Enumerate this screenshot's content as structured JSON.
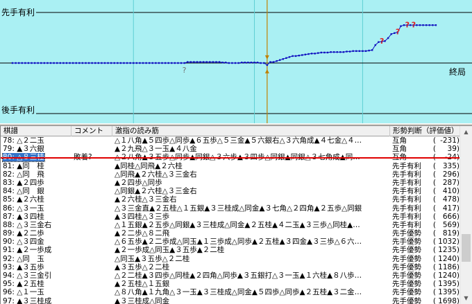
{
  "chart": {
    "label_top": "先手有利",
    "label_bottom": "後手有利",
    "label_end": "終局",
    "colors": {
      "background": "#aaf0f3",
      "line": "#1010c0",
      "axis": "#000000",
      "current_marker": "#c08000",
      "blunder_marker": "#e02020",
      "doubt_marker": "#707070"
    }
  },
  "chart_data": {
    "type": "line",
    "title": "",
    "xlabel": "",
    "ylabel": "",
    "x_range": [
      0,
      140
    ],
    "y_range": [
      -1.0,
      1.0
    ],
    "x_gridlines": [
      38,
      76,
      110
    ],
    "current_move": 80,
    "series": [
      {
        "name": "",
        "values": [
          0,
          0,
          0,
          0,
          0,
          0,
          0,
          0,
          0,
          0,
          0,
          0,
          0,
          0,
          0,
          0,
          0,
          0,
          0,
          0,
          0,
          0,
          0,
          0,
          0,
          0,
          0,
          0,
          0,
          0,
          0,
          0,
          0,
          0,
          0,
          0,
          0,
          0,
          0,
          0,
          0,
          0,
          0,
          0,
          0,
          0,
          0,
          0,
          0,
          0,
          0,
          0,
          0,
          0,
          0,
          0.02,
          0.02,
          0.02,
          0.02,
          0.02,
          0.02,
          0.02,
          0.02,
          0.02,
          0.02,
          0.02,
          0.01,
          0.01,
          0,
          0,
          0,
          0,
          0.01,
          0.01,
          0.01,
          0.01,
          0.01,
          0.01,
          0,
          0,
          -0.04,
          0.02,
          0.02,
          0.04,
          0.06,
          0.08,
          0.1,
          0.12,
          0.14,
          0.14,
          0.15,
          0.16,
          0.17,
          0.18,
          0.19,
          0.19,
          0.2,
          0.21,
          0.21,
          0.21,
          0.22,
          0.22,
          0.22,
          0.22,
          0.22,
          0.23,
          0.23,
          0.24,
          0.24,
          0.24,
          0.24,
          0.24,
          0.25,
          0.26,
          0.36,
          0.42,
          0.43,
          0.44,
          0.5,
          0.58,
          0.6,
          0.62,
          0.74,
          0.76,
          0.76,
          0.76,
          0.76,
          0.76,
          0.76,
          0.76,
          0.76,
          0.76,
          0.76,
          0.76
        ]
      }
    ],
    "markers": [
      {
        "x": 54,
        "symbol": "?"
      },
      {
        "x": 116,
        "symbol": "?"
      },
      {
        "x": 121,
        "symbol": "?"
      },
      {
        "x": 124,
        "symbol": "?"
      },
      {
        "x": 126,
        "symbol": "?"
      }
    ]
  },
  "list": {
    "headers": [
      "棋譜",
      "コメント",
      "激指の読み筋",
      "形勢判断（評価値）"
    ],
    "rows": [
      {
        "move": "78: △２二玉",
        "comment": "",
        "line": "△１八角▲５四歩△同歩▲６五歩△５三金▲５六銀右△３六角成▲４七金△４…",
        "judge": "互角",
        "paren": "(",
        "score": "-231)"
      },
      {
        "move": "79: ▲３六銀",
        "comment": "",
        "line": "▲２九飛△３一玉▲４八金",
        "judge": "互角",
        "paren": "(",
        "score": "39)"
      },
      {
        "move": "80: △８三桂",
        "comment": "敗着?",
        "line": "△２八角▲３五歩△同歩▲同銀△３六歩▲３四歩△同銀▲同銀△３七角成▲同…",
        "judge": "互角",
        "paren": "(",
        "score": "-24)",
        "selected": true
      },
      {
        "move": "81: ▲同　桂",
        "comment": "",
        "line": "▲同桂△同飛▲２六桂",
        "judge": "先手有利",
        "paren": "(",
        "score": "335)"
      },
      {
        "move": "82: △同　飛",
        "comment": "",
        "line": "△同飛▲２六桂△３三金右",
        "judge": "先手有利",
        "paren": "(",
        "score": "296)"
      },
      {
        "move": "83: ▲２四歩",
        "comment": "",
        "line": "▲２四歩△同歩",
        "judge": "先手有利",
        "paren": "(",
        "score": "287)"
      },
      {
        "move": "84: △同　銀",
        "comment": "",
        "line": "△同銀▲２六桂△３三金右",
        "judge": "先手有利",
        "paren": "(",
        "score": "410)"
      },
      {
        "move": "85: ▲２六桂",
        "comment": "",
        "line": "▲２六桂△３三金右",
        "judge": "先手有利",
        "paren": "(",
        "score": "478)"
      },
      {
        "move": "86: △３一玉",
        "comment": "",
        "line": "△３三金直▲２五桂△１五銀▲３三桂成△同金▲３七角△２四角▲２五歩△同銀",
        "judge": "先手有利",
        "paren": "(",
        "score": "417)"
      },
      {
        "move": "87: ▲３四桂",
        "comment": "",
        "line": "▲３四桂△３三歩",
        "judge": "先手有利",
        "paren": "(",
        "score": "666)"
      },
      {
        "move": "88: △３三金右",
        "comment": "",
        "line": "△１五銀▲２五歩△同銀▲３三桂成△同金▲２五桂▲４二玉▲３三歩△同桂▲…",
        "judge": "先手有利",
        "paren": "(",
        "score": "569)"
      },
      {
        "move": "89: ▲２二歩",
        "comment": "",
        "line": "▲２二歩△８二飛",
        "judge": "先手優勢",
        "paren": "(",
        "score": "819)"
      },
      {
        "move": "90: △３四金",
        "comment": "",
        "line": "△６五歩▲２二歩成△同玉▲１三歩成△同歩▲２五桂▲３四金▲３三歩△６六…",
        "judge": "先手優勢",
        "paren": "(",
        "score": "1032)"
      },
      {
        "move": "91: ▲２一歩成",
        "comment": "",
        "line": "▲２一歩成△同玉▲３五歩▲２二桂",
        "judge": "先手優勢",
        "paren": "(",
        "score": "1235)"
      },
      {
        "move": "92: △同　玉",
        "comment": "",
        "line": "△同玉▲３五歩△２二桂",
        "judge": "先手優勢",
        "paren": "(",
        "score": "1240)"
      },
      {
        "move": "93: ▲３五歩",
        "comment": "",
        "line": "▲３五歩△２二桂",
        "judge": "先手優勢",
        "paren": "(",
        "score": "1186)"
      },
      {
        "move": "94: △３三金引",
        "comment": "",
        "line": "△２二桂▲３四歩△同桂▲２四角△同歩▲３五銀打△３一玉▲１六桂▲８八歩…",
        "judge": "先手優勢",
        "paren": "(",
        "score": "1240)"
      },
      {
        "move": "95: ▲２五桂",
        "comment": "",
        "line": "▲２五桂△１五銀",
        "judge": "先手優勢",
        "paren": "(",
        "score": "1395)"
      },
      {
        "move": "96: △１一玉",
        "comment": "",
        "line": "△８八角▲１九角△３一玉▲３三桂成△同金▲５四歩△同歩▲２五桂▲３二金…",
        "judge": "先手優勢",
        "paren": "(",
        "score": "1395)"
      },
      {
        "move": "97: ▲３三桂成",
        "comment": "",
        "line": "▲３三桂成△同金",
        "judge": "先手優勢",
        "paren": "(",
        "score": "1698)"
      },
      {
        "move": "98: △同　銀",
        "comment": "",
        "line": "△同銀▲３四歩△同銀▲１三歩成△同歩▲同香不成",
        "judge": "先手優勢",
        "paren": "(",
        "score": "1613)"
      }
    ]
  },
  "scrollbar": {
    "up_icon": "▲",
    "down_icon": "▼"
  }
}
